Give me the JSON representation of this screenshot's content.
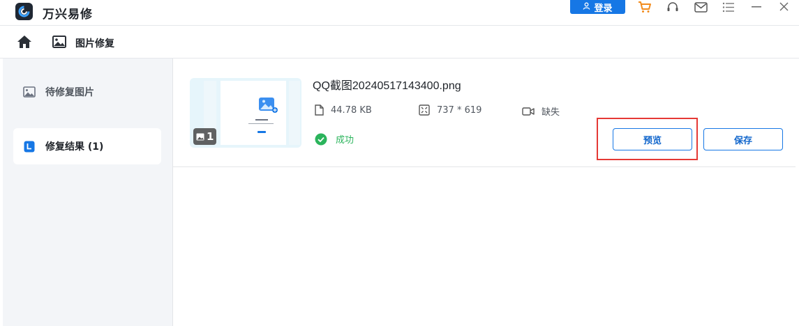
{
  "app": {
    "title": "万兴易修",
    "login_label": "登录"
  },
  "navbar": {
    "title": "图片修复"
  },
  "sidebar": {
    "items": [
      {
        "label": "待修复图片",
        "icon": "image-icon",
        "active": false
      },
      {
        "label": "修复结果 (1)",
        "icon": "result-icon",
        "active": true
      }
    ]
  },
  "result": {
    "file_name": "QQ截图20240517143400.png",
    "thumb_count": "1",
    "file_size": "44.78  KB",
    "dimensions": "737 * 619",
    "video_status": "缺失",
    "status": "成功",
    "preview_label": "预览",
    "save_label": "保存"
  },
  "colors": {
    "accent": "#1677e5",
    "success": "#2bb45c",
    "highlight": "#e53935",
    "cart": "#f28b1c"
  }
}
